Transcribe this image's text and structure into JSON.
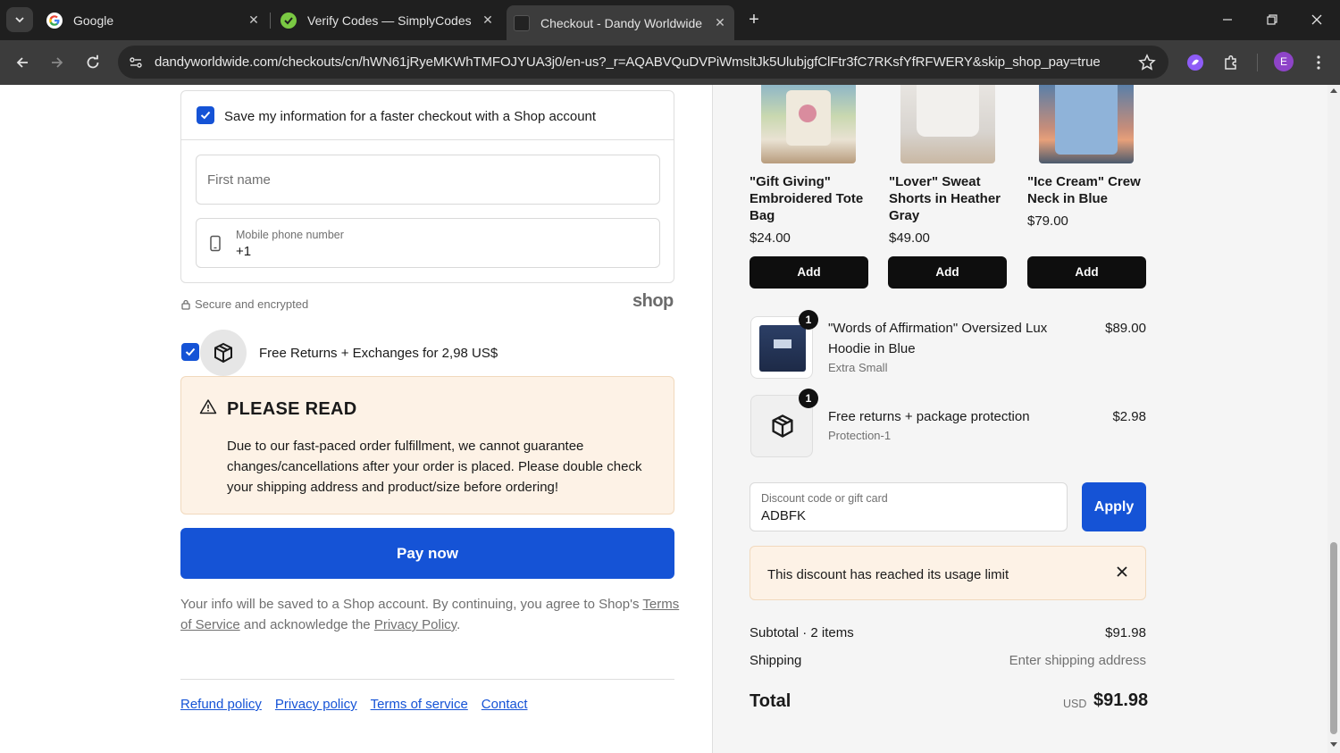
{
  "browser": {
    "tabs": [
      {
        "title": "Google",
        "close": "✕"
      },
      {
        "title": "Verify Codes — SimplyCodes",
        "close": "✕"
      },
      {
        "title": "Checkout - Dandy Worldwide",
        "close": "✕"
      }
    ],
    "new_tab": "+",
    "url": "dandyworldwide.com/checkouts/cn/hWN61jRyeMKWhTMFOJYUA3j0/en-us?_r=AQABVQuDVPiWmsltJk5UlubjgfClFtr3fC7RKsfYfRFWERY&skip_shop_pay=true",
    "profile_initial": "E"
  },
  "shop_box": {
    "save_label": "Save my information for a faster checkout with a Shop account",
    "first_name_placeholder": "First name",
    "phone_label": "Mobile phone number",
    "phone_value": "+1",
    "secure_text": "Secure and encrypted",
    "shop_logo": "shop"
  },
  "returns": {
    "label": "Free Returns + Exchanges for 2,98 US$"
  },
  "notice": {
    "title": "PLEASE READ",
    "body": "Due to our fast-paced order fulfillment, we cannot guarantee changes/cancellations after your order is placed. Please double check your shipping address and product/size before ordering!"
  },
  "pay_button": "Pay now",
  "legal": {
    "prefix": "Your info will be saved to a Shop account. By continuing, you agree to Shop's ",
    "terms": "Terms of Service",
    "middle": " and acknowledge the ",
    "privacy": "Privacy Policy",
    "suffix": "."
  },
  "footer": {
    "links": [
      "Refund policy",
      "Privacy policy",
      "Terms of service",
      "Contact"
    ]
  },
  "upsells": [
    {
      "name": "\"Gift Giving\" Embroidered Tote Bag",
      "price": "$24.00",
      "button": "Add"
    },
    {
      "name": "\"Lover\" Sweat Shorts in Heather Gray",
      "price": "$49.00",
      "button": "Add"
    },
    {
      "name": "\"Ice Cream\" Crew Neck in Blue",
      "price": "$79.00",
      "button": "Add"
    }
  ],
  "cart_items": [
    {
      "qty": "1",
      "name": "\"Words of Affirmation\" Oversized Lux Hoodie in Blue",
      "variant": "Extra Small",
      "price": "$89.00"
    },
    {
      "qty": "1",
      "name": "Free returns + package protection",
      "variant": "Protection-1",
      "price": "$2.98"
    }
  ],
  "discount": {
    "label": "Discount code or gift card",
    "value": "ADBFK",
    "apply": "Apply",
    "error": "This discount has reached its usage limit"
  },
  "summary": {
    "subtotal_label": "Subtotal · 2 items",
    "subtotal_value": "$91.98",
    "shipping_label": "Shipping",
    "shipping_value": "Enter shipping address",
    "total_label": "Total",
    "currency": "USD",
    "total_value": "$91.98"
  },
  "colors": {
    "accent": "#1553d6",
    "notice_bg": "#fdf2e6",
    "dark_button": "#0e0e0e"
  }
}
